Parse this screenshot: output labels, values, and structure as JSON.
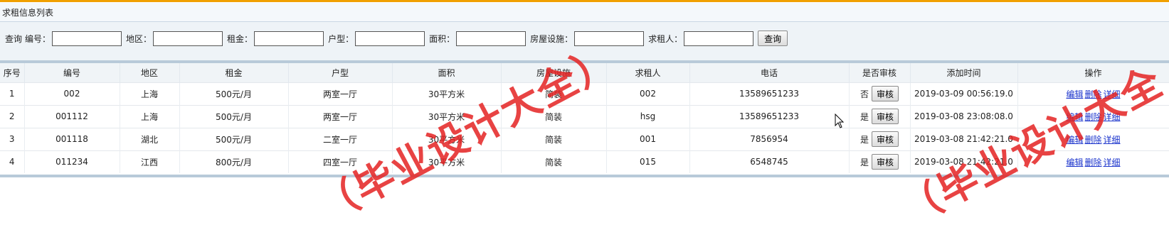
{
  "panel": {
    "title": "求租信息列表"
  },
  "search": {
    "prefix": "查询",
    "fields": [
      {
        "label": "编号：",
        "value": ""
      },
      {
        "label": "地区：",
        "value": ""
      },
      {
        "label": "租金：",
        "value": ""
      },
      {
        "label": "户型：",
        "value": ""
      },
      {
        "label": "面积：",
        "value": ""
      },
      {
        "label": "房屋设施：",
        "value": ""
      },
      {
        "label": "求租人：",
        "value": ""
      }
    ],
    "button": "查询"
  },
  "table": {
    "headers": [
      "序号",
      "编号",
      "地区",
      "租金",
      "户型",
      "面积",
      "房屋设施",
      "求租人",
      "电话",
      "是否审核",
      "添加时间",
      "操作"
    ],
    "audit_button": "审核",
    "actions": [
      "编辑",
      "删除",
      "详细"
    ],
    "rows": [
      {
        "seq": "1",
        "code": "002",
        "region": "上海",
        "rent": "500元/月",
        "layout": "两室一厅",
        "area": "30平方米",
        "facility": "简装",
        "renter": "002",
        "phone": "13589651233",
        "audited": "否",
        "time": "2019-03-09 00:56:19.0"
      },
      {
        "seq": "2",
        "code": "001112",
        "region": "上海",
        "rent": "500元/月",
        "layout": "两室一厅",
        "area": "30平方米",
        "facility": "简装",
        "renter": "hsg",
        "phone": "13589651233",
        "audited": "是",
        "time": "2019-03-08 23:08:08.0"
      },
      {
        "seq": "3",
        "code": "001118",
        "region": "湖北",
        "rent": "500元/月",
        "layout": "二室一厅",
        "area": "30平方米",
        "facility": "简装",
        "renter": "001",
        "phone": "7856954",
        "audited": "是",
        "time": "2019-03-08 21:42:21.0"
      },
      {
        "seq": "4",
        "code": "011234",
        "region": "江西",
        "rent": "800元/月",
        "layout": "四室一厅",
        "area": "30平方米",
        "facility": "简装",
        "renter": "015",
        "phone": "6548745",
        "audited": "是",
        "time": "2019-03-08 21:42:21.0"
      }
    ]
  },
  "watermarks": [
    "（毕业设计大全）",
    "（毕业设计大全"
  ],
  "colors": {
    "watermark": "#e42222",
    "link": "#1a33cc",
    "accent_line": "#f0a000"
  }
}
